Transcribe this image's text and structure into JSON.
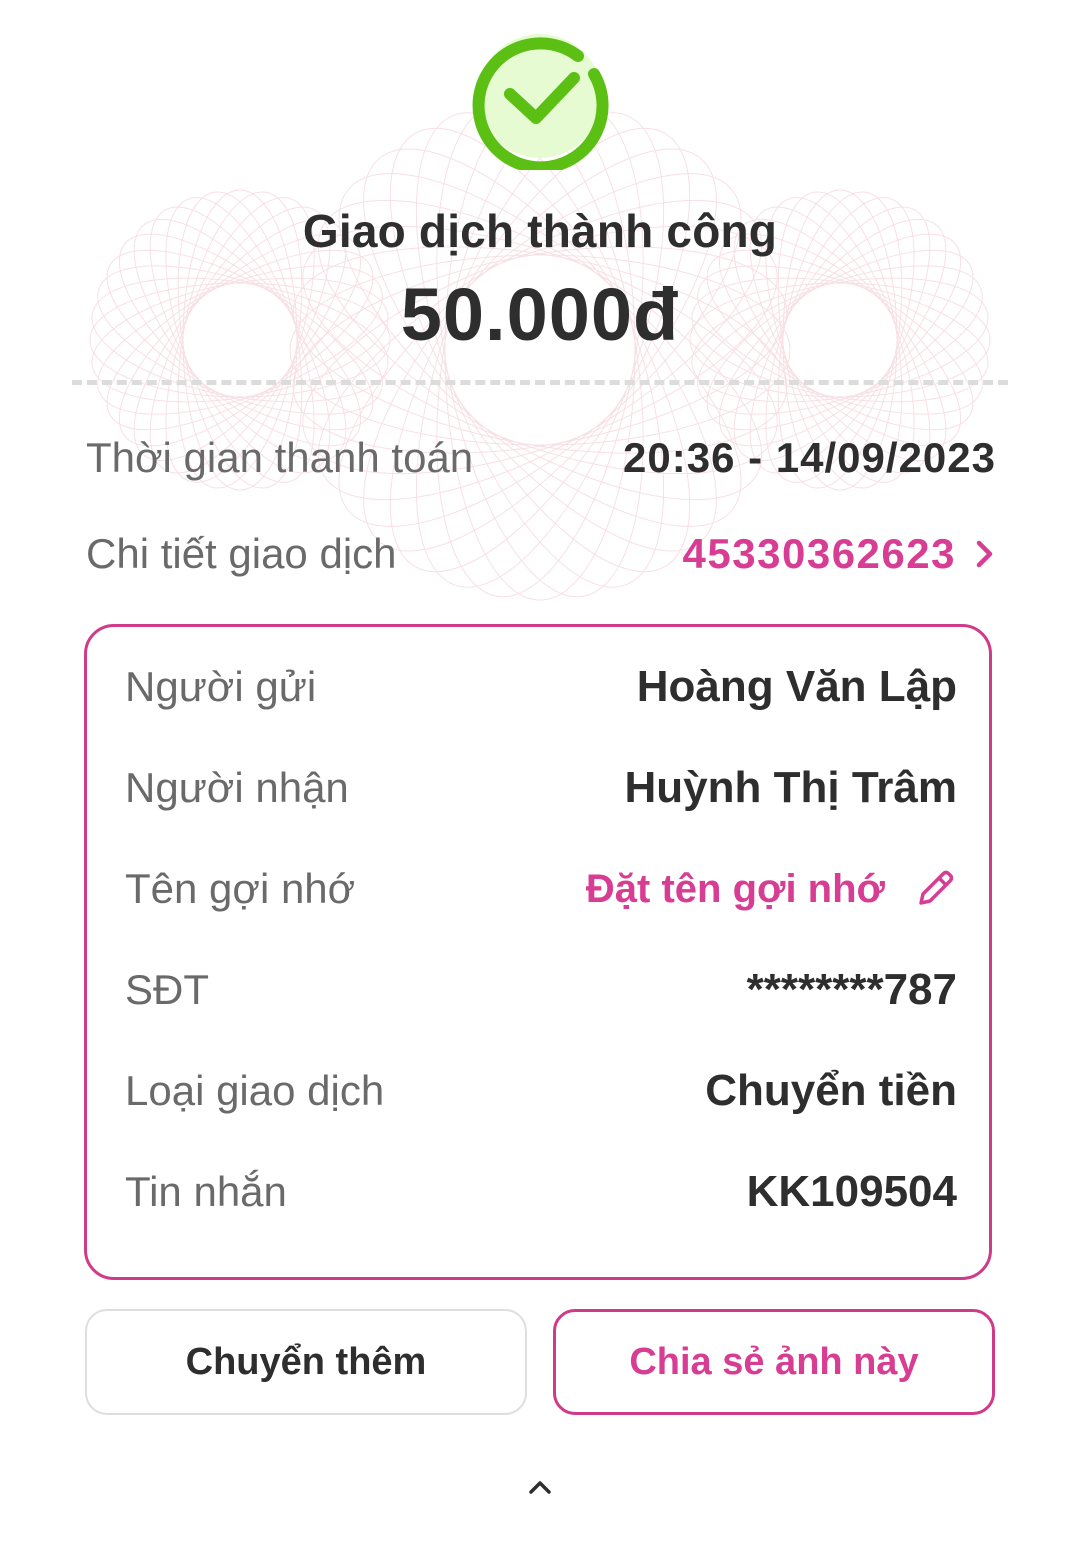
{
  "header": {
    "status_icon": "check-circle-icon",
    "title": "Giao dịch thành công",
    "amount": "50.000đ"
  },
  "summary": {
    "payment_time_label": "Thời gian thanh toán",
    "payment_time_value": "20:36 - 14/09/2023",
    "detail_label": "Chi tiết giao dịch",
    "detail_value": "45330362623",
    "detail_icon": "chevron-right-icon"
  },
  "details": {
    "sender_label": "Người gửi",
    "sender_value": "Hoàng Văn Lập",
    "receiver_label": "Người nhận",
    "receiver_value": "Huỳnh Thị Trâm",
    "nickname_label": "Tên gợi nhớ",
    "nickname_action": "Đặt tên gợi nhớ",
    "nickname_icon": "pencil-icon",
    "phone_label": "SĐT",
    "phone_value": "********787",
    "type_label": "Loại giao dịch",
    "type_value": "Chuyển tiền",
    "message_label": "Tin nhắn",
    "message_value": "KK109504"
  },
  "actions": {
    "transfer_more": "Chuyển thêm",
    "share_image": "Chia sẻ ảnh này",
    "expand_icon": "chevron-up-icon"
  },
  "colors": {
    "accent": "#d63d93",
    "success": "#5cbf14",
    "success_fill": "#e6fbd2",
    "text": "#2e2e2e",
    "muted": "#6a6a6a"
  }
}
